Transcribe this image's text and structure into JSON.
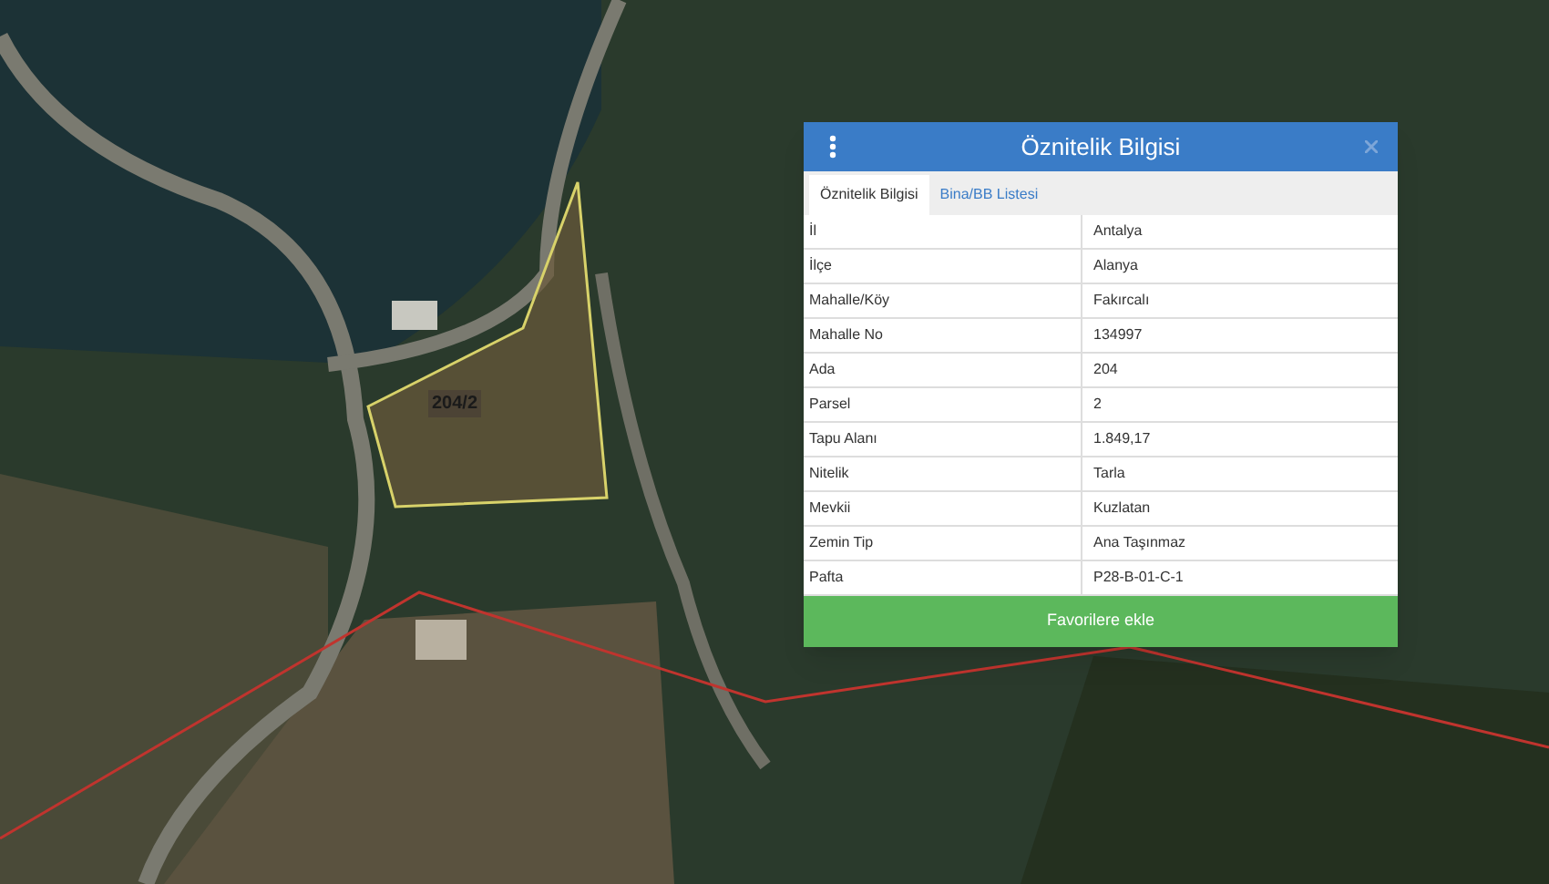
{
  "map": {
    "parcel_label": "204/2"
  },
  "panel": {
    "title": "Öznitelik Bilgisi",
    "tabs": [
      {
        "label": "Öznitelik Bilgisi",
        "selected": true
      },
      {
        "label": "Bina/BB Listesi",
        "selected": false
      }
    ],
    "rows": [
      {
        "name": "İl",
        "value": "Antalya"
      },
      {
        "name": "İlçe",
        "value": "Alanya"
      },
      {
        "name": "Mahalle/Köy",
        "value": "Fakırcalı"
      },
      {
        "name": "Mahalle No",
        "value": "134997"
      },
      {
        "name": "Ada",
        "value": "204"
      },
      {
        "name": "Parsel",
        "value": "2"
      },
      {
        "name": "Tapu Alanı",
        "value": "1.849,17"
      },
      {
        "name": "Nitelik",
        "value": "Tarla"
      },
      {
        "name": "Mevkii",
        "value": "Kuzlatan"
      },
      {
        "name": "Zemin Tip",
        "value": "Ana Taşınmaz"
      },
      {
        "name": "Pafta",
        "value": "P28-B-01-C-1"
      }
    ],
    "button": "Favorilere ekle"
  }
}
